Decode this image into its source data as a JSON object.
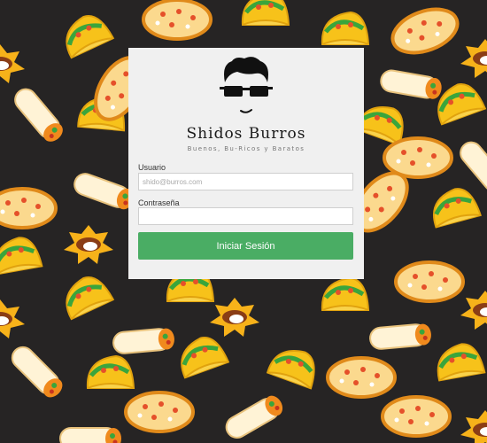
{
  "brand": {
    "name": "Shidos Burros",
    "tagline": "Buenos, Bu-Ricos y Baratos",
    "logo_icon": "guy-with-sunglasses-icon"
  },
  "login": {
    "username_label": "Usuario",
    "username_placeholder": "shido@burros.com",
    "username_value": "",
    "password_label": "Contraseña",
    "password_value": "",
    "submit_label": "Iniciar Sesión"
  },
  "colors": {
    "background": "#262424",
    "card": "#f0f0f0",
    "accent": "#4aad64",
    "tortilla": "#fbd98e",
    "cheese": "#f7c21a"
  }
}
